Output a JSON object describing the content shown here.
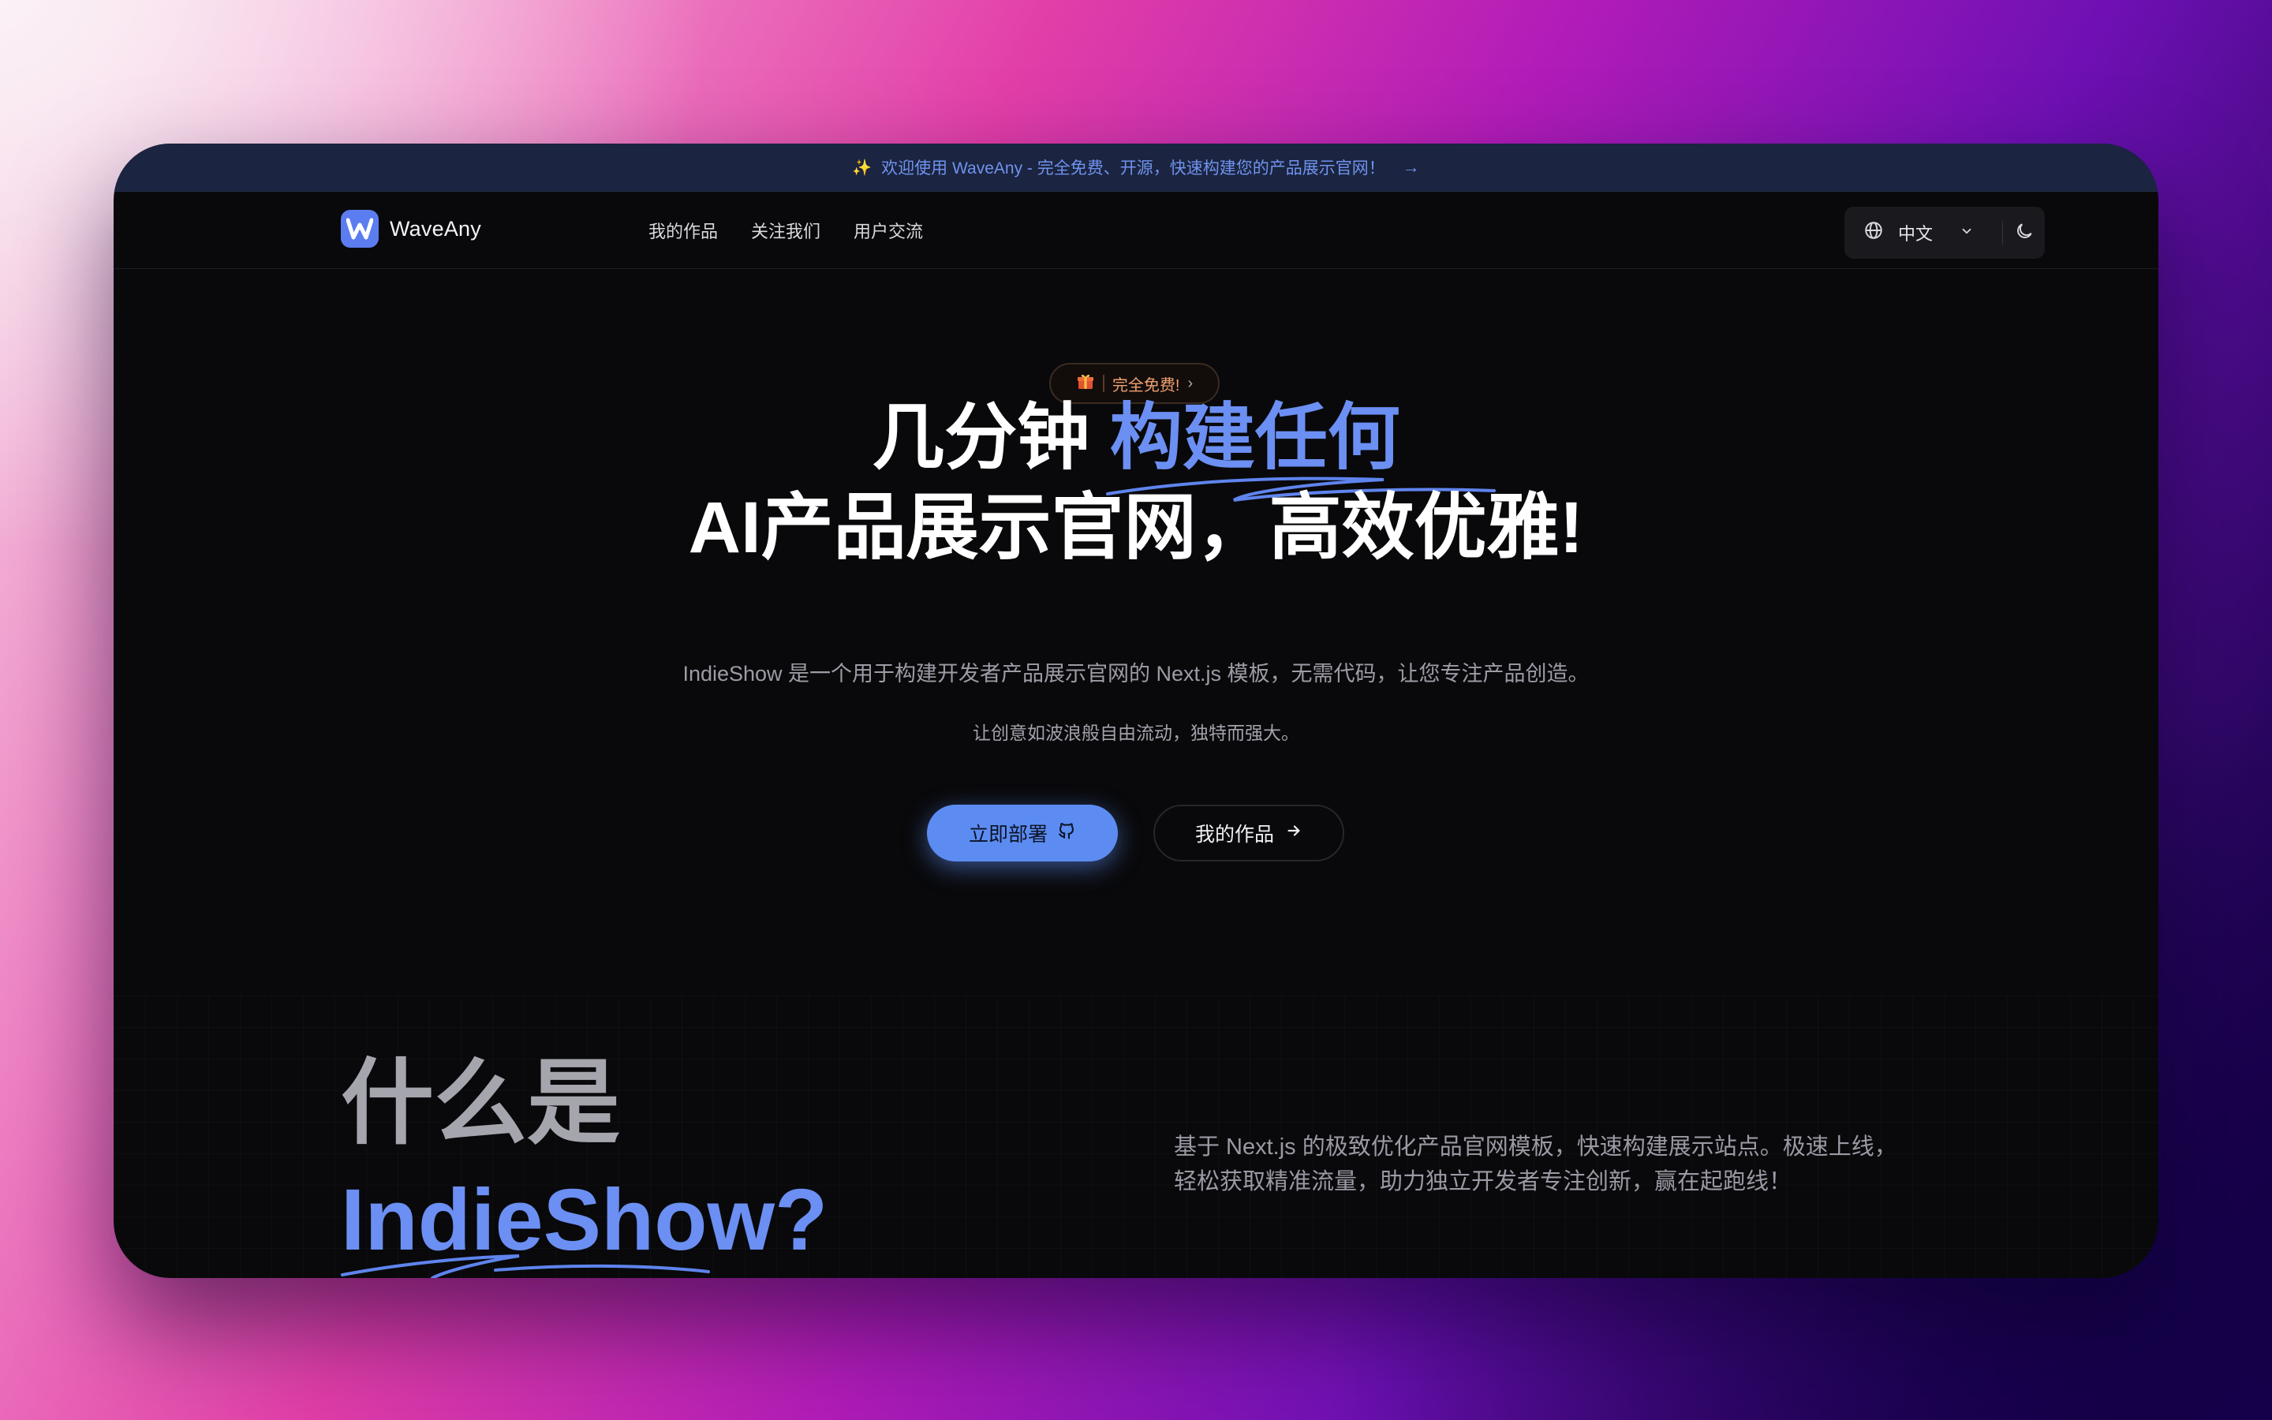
{
  "announcement": {
    "text": "欢迎使用 WaveAny - 完全免费、开源，快速构建您的产品展示官网！",
    "arrow": "→"
  },
  "navbar": {
    "brand": "WaveAny",
    "links": [
      "我的作品",
      "关注我们",
      "用户交流"
    ],
    "language": "中文"
  },
  "hero": {
    "badge": "完全免费!",
    "title_line1_plain": "几分钟 ",
    "title_line1_accent": "构建任何",
    "title_line2": "AI产品展示官网，高效优雅!",
    "description": "IndieShow 是一个用于构建开发者产品展示官网的 Next.js 模板，无需代码，让您专注产品创造。",
    "subtitle": "让创意如波浪般自由流动，独特而强大。",
    "primary_button": "立即部署",
    "secondary_button": "我的作品"
  },
  "what_is": {
    "title_line1": "什么是",
    "title_line2": "IndieShow?",
    "description_line1": "基于 Next.js 的极致优化产品官网模板，快速构建展示站点。极速上线，",
    "description_line2": "轻松获取精准流量，助力独立开发者专注创新，赢在起跑线！"
  },
  "colors": {
    "accent": "#6b8ff2",
    "primary_button": "#5c8cf2",
    "announcement_bg": "#1b2440",
    "page_bg": "#09090b",
    "badge_text": "#f0a070"
  },
  "icons": [
    "sparkle-icon",
    "arrow-right-icon",
    "w-logo-icon",
    "globe-icon",
    "chevron-down-icon",
    "moon-icon",
    "gift-icon",
    "chevron-right-icon",
    "github-icon"
  ]
}
